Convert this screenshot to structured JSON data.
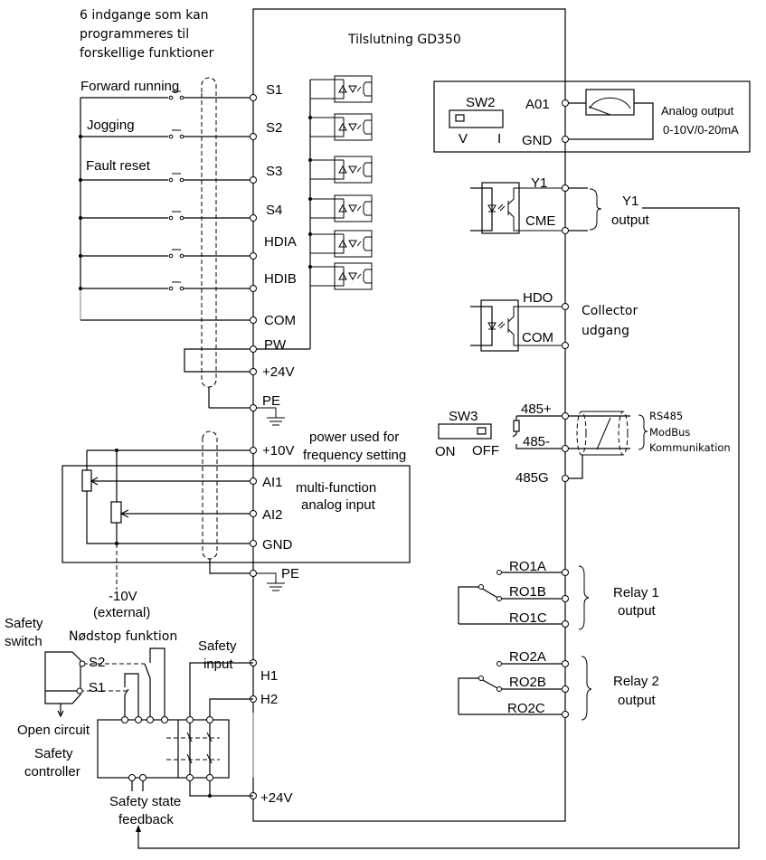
{
  "diagram": {
    "title": "Tilslutning GD350",
    "notes": {
      "inputs_header": [
        "6 indgange som kan",
        "programmeres til",
        "forskellige funktioner"
      ],
      "analog_output": [
        "Analog output",
        "0-10V/0-20mA"
      ],
      "y1_output": [
        "Y1",
        "output"
      ],
      "collector": [
        "Collector",
        "udgang"
      ],
      "rs485": [
        "RS485",
        "ModBus",
        "Kommunikation"
      ],
      "power_freq": [
        "power used for",
        "frequency setting"
      ],
      "analog_input": [
        "multi-function",
        "analog input"
      ],
      "minus10v": [
        "-10V",
        "(external)"
      ],
      "safety_switch": [
        "Safety",
        "switch"
      ],
      "nodstop": "Nødstop funktion",
      "safety_input": [
        "Safety",
        "input"
      ],
      "open_circuit": "Open circuit",
      "safety_controller": [
        "Safety",
        "controller"
      ],
      "safety_feedback": [
        "Safety state",
        "feedback"
      ],
      "relay1": [
        "Relay 1",
        "output"
      ],
      "relay2": [
        "Relay 2",
        "output"
      ]
    },
    "input_functions": [
      "Forward running",
      "Jogging",
      "Fault reset"
    ],
    "left_terminals": [
      "S1",
      "S2",
      "S3",
      "S4",
      "HDIA",
      "HDIB",
      "COM",
      "PW",
      "+24V",
      "PE",
      "+10V",
      "AI1",
      "AI2",
      "GND",
      "PE",
      "H1",
      "H2",
      "+24V"
    ],
    "right_terminals": {
      "sw2": "SW2",
      "sw2_v": "V",
      "sw2_i": "I",
      "a01": "A01",
      "gnd": "GND",
      "y1": "Y1",
      "cme": "CME",
      "hdo": "HDO",
      "com": "COM",
      "sw3": "SW3",
      "sw3_on": "ON",
      "sw3_off": "OFF",
      "p485": "485+",
      "m485": "485-",
      "g485": "485G",
      "ro1a": "RO1A",
      "ro1b": "RO1B",
      "ro1c": "RO1C",
      "ro2a": "RO2A",
      "ro2b": "RO2B",
      "ro2c": "RO2C"
    },
    "safety_switch_contacts": [
      "S2",
      "S1"
    ]
  }
}
